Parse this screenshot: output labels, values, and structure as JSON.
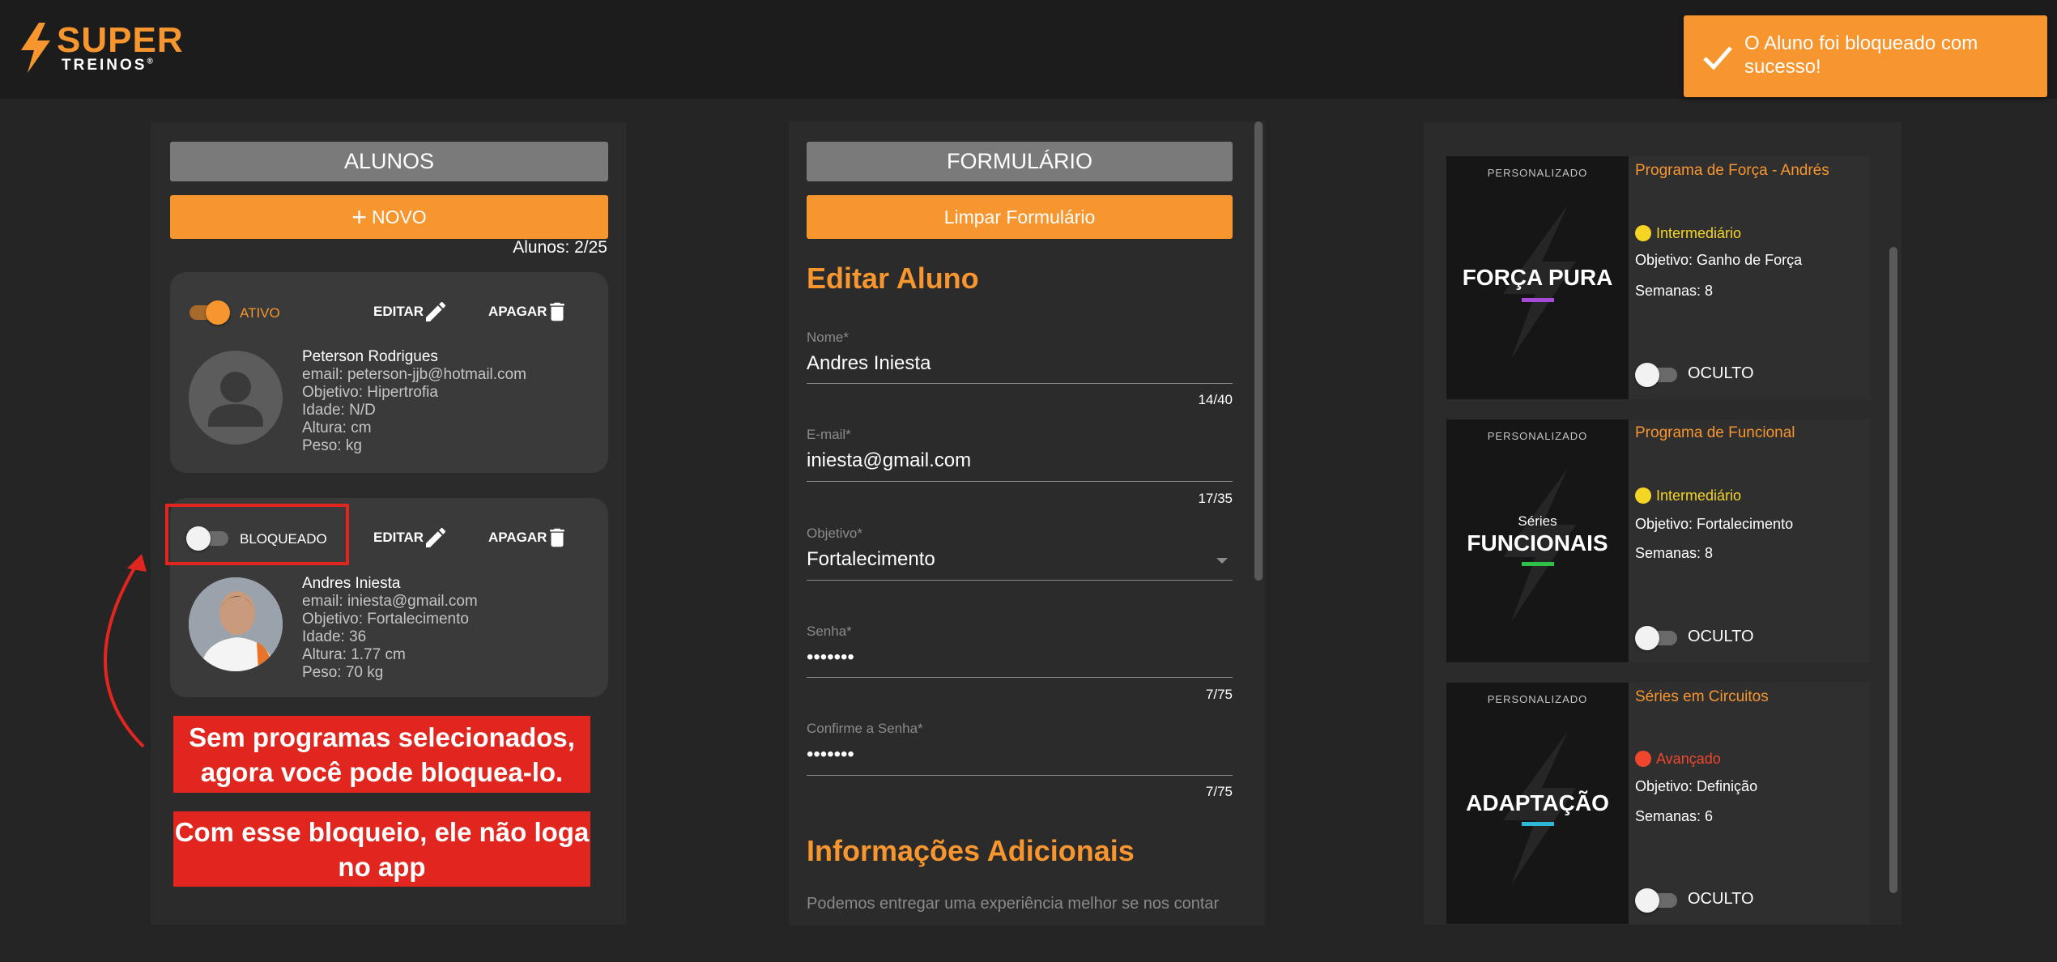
{
  "brand": {
    "name_top": "SUPER",
    "name_bottom": "TREINOS",
    "mark": "®"
  },
  "toast": {
    "message": "O Aluno foi bloqueado com sucesso!",
    "icon": "check-icon"
  },
  "alunos": {
    "header": "ALUNOS",
    "new_button": "NOVO",
    "count": "Alunos: 2/25",
    "cards": [
      {
        "status": "ATIVO",
        "active": true,
        "edit": "EDITAR",
        "delete": "APAGAR",
        "name": "Peterson Rodrigues",
        "email": "email: peterson-jjb@hotmail.com",
        "objetivo": "Objetivo: Hipertrofia",
        "idade": "Idade: N/D",
        "altura": "Altura: cm",
        "peso": "Peso: kg"
      },
      {
        "status": "BLOQUEADO",
        "active": false,
        "edit": "EDITAR",
        "delete": "APAGAR",
        "name": "Andres Iniesta",
        "email": "email: iniesta@gmail.com",
        "objetivo": "Objetivo: Fortalecimento",
        "idade": "Idade: 36",
        "altura": "Altura: 1.77 cm",
        "peso": "Peso: 70 kg"
      }
    ]
  },
  "annotations": {
    "callout_1": "Sem programas selecionados, agora você pode bloquea-lo.",
    "callout_2": "Com esse bloqueio, ele não loga no app"
  },
  "form": {
    "header": "FORMULÁRIO",
    "clear_button": "Limpar Formulário",
    "title": "Editar Aluno",
    "fields": [
      {
        "label": "Nome*",
        "value": "Andres Iniesta",
        "counter": "14/40"
      },
      {
        "label": "E-mail*",
        "value": "iniesta@gmail.com",
        "counter": "17/35"
      },
      {
        "label": "Objetivo*",
        "value": "Fortalecimento"
      },
      {
        "label": "Senha*",
        "value": "•••••••",
        "counter": "7/75"
      },
      {
        "label": "Confirme a Senha*",
        "value": "•••••••",
        "counter": "7/75"
      }
    ],
    "additional_title": "Informações Adicionais",
    "additional_desc": "Podemos entregar uma experiência melhor se nos contar"
  },
  "programs": [
    {
      "tag": "PERSONALIZADO",
      "thumb_sub": "",
      "thumb_title": "FORÇA PURA",
      "accent": "#a64bd8",
      "title": "Programa de Força - Andrés",
      "level": "Intermediário",
      "level_color": "#f5d524",
      "objetivo": "Objetivo: Ganho de Força",
      "semanas": "Semanas: 8",
      "visibility": "OCULTO"
    },
    {
      "tag": "PERSONALIZADO",
      "thumb_sub": "Séries",
      "thumb_title": "FUNCIONAIS",
      "accent": "#2fc04a",
      "title": "Programa de Funcional",
      "level": "Intermediário",
      "level_color": "#f5d524",
      "objetivo": "Objetivo: Fortalecimento",
      "semanas": "Semanas: 8",
      "visibility": "OCULTO"
    },
    {
      "tag": "PERSONALIZADO",
      "thumb_sub": "",
      "thumb_title": "ADAPTAÇÃO",
      "accent": "#2fb7d8",
      "title": "Séries em Circuitos",
      "level": "Avançado",
      "level_color": "#f0462e",
      "objetivo": "Objetivo: Definição",
      "semanas": "Semanas: 6",
      "visibility": "OCULTO"
    }
  ],
  "colors": {
    "accent": "#f7952e",
    "annotation_red": "#e0261e"
  }
}
